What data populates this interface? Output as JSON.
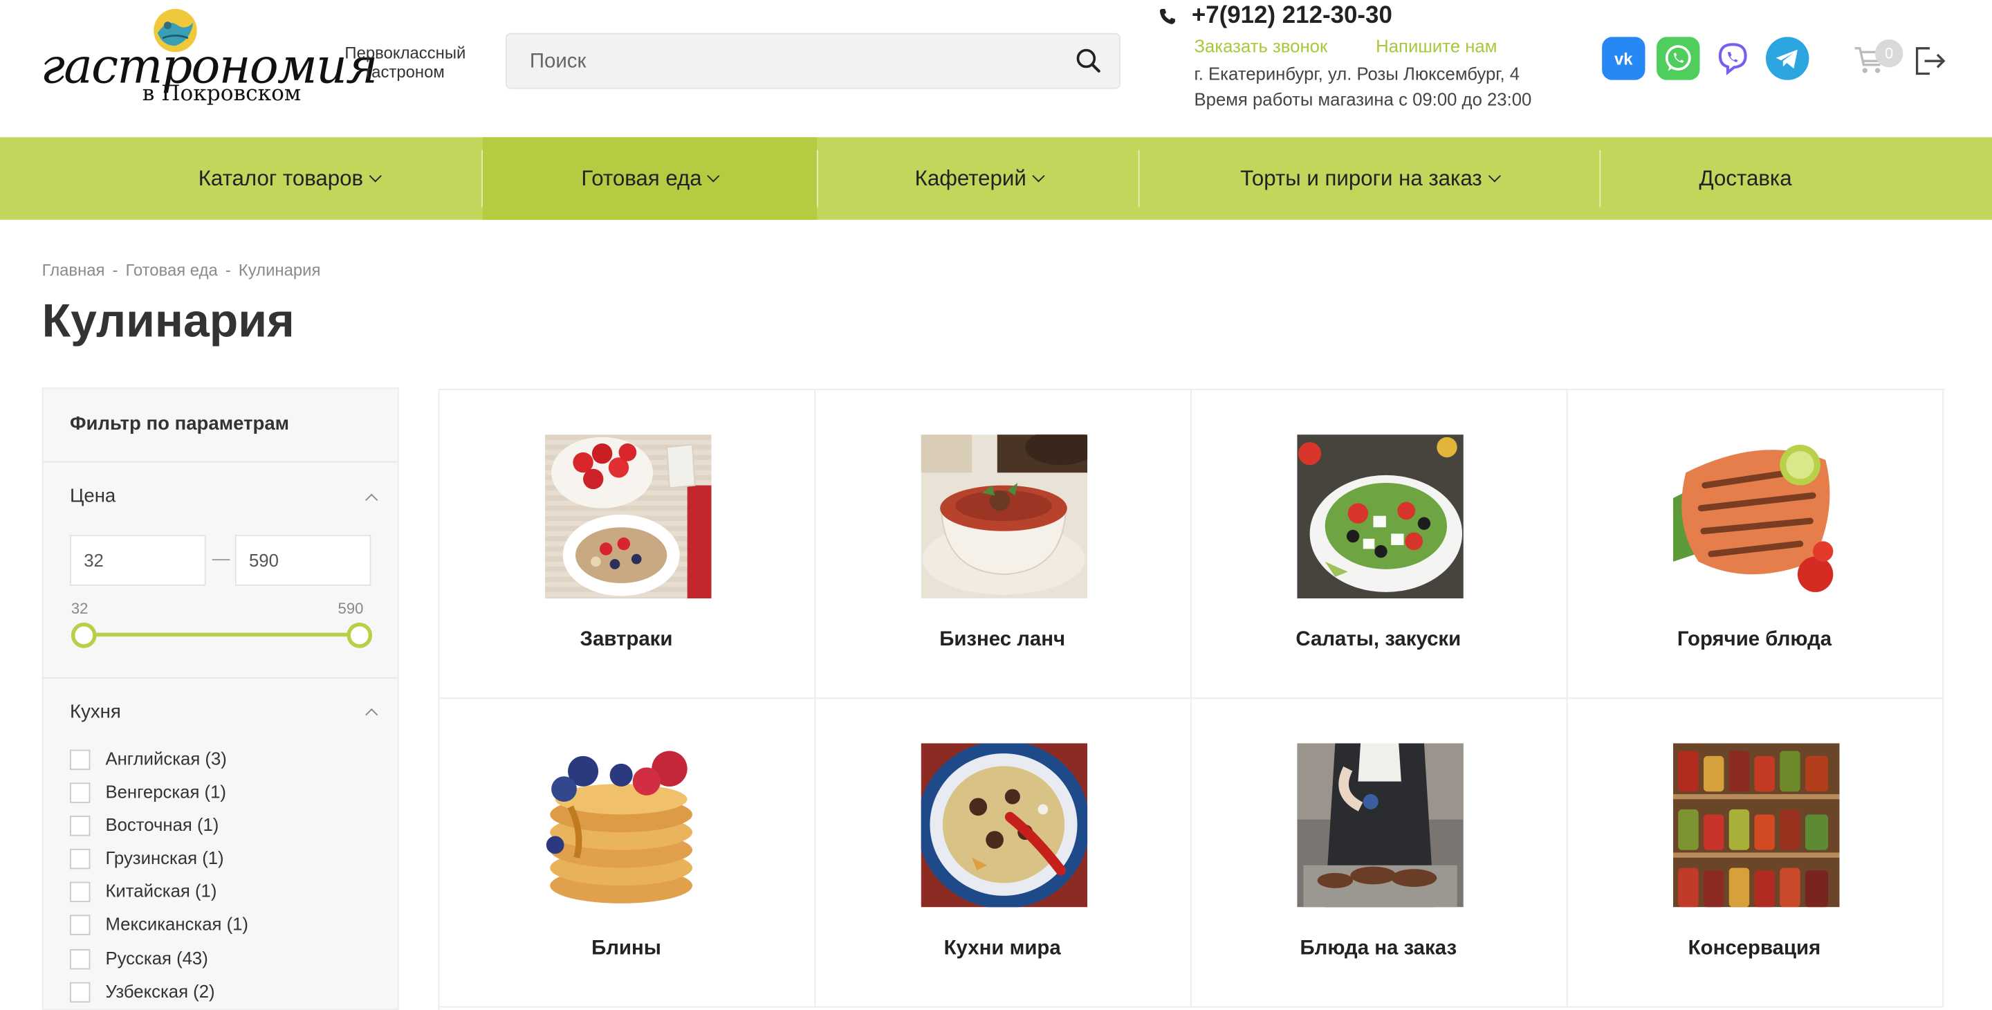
{
  "header": {
    "logo_text": "гастрономия",
    "logo_sub": "в Покровском",
    "tagline": "Первоклассный гастроном",
    "search_placeholder": "Поиск",
    "phone": "+7(912) 212-30-30",
    "callback": "Заказать звонок",
    "write_us": "Напишите нам",
    "address": "г. Екатеринбург, ул. Розы Люксембург, 4",
    "hours": "Время работы магазина с 09:00 до 23:00",
    "social": [
      {
        "name": "vk-icon",
        "color": "#2787f5"
      },
      {
        "name": "whatsapp-icon",
        "color": "#4fce5d"
      },
      {
        "name": "viber-icon",
        "color": "#7360f2"
      },
      {
        "name": "telegram-icon",
        "color": "#2ca5e0"
      }
    ],
    "cart_count": "0"
  },
  "nav": [
    {
      "label": "Каталог товаров",
      "has_dropdown": true
    },
    {
      "label": "Готовая еда",
      "has_dropdown": true,
      "active": true
    },
    {
      "label": "Кафетерий",
      "has_dropdown": true
    },
    {
      "label": "Торты и пироги на заказ",
      "has_dropdown": true
    },
    {
      "label": "Доставка",
      "has_dropdown": false
    }
  ],
  "breadcrumbs": [
    "Главная",
    "Готовая еда",
    "Кулинария"
  ],
  "page_title": "Кулинария",
  "filter": {
    "title": "Фильтр по параметрам",
    "price": {
      "title": "Цена",
      "min_value": "32",
      "max_value": "590",
      "range_min_label": "32",
      "range_max_label": "590"
    },
    "cuisine": {
      "title": "Кухня",
      "options": [
        "Английская (3)",
        "Венгерская (1)",
        "Восточная (1)",
        "Грузинская (1)",
        "Китайская (1)",
        "Мексиканская (1)",
        "Русская (43)",
        "Узбекская (2)"
      ]
    }
  },
  "categories": [
    {
      "label": "Завтраки",
      "image": "breakfast-image"
    },
    {
      "label": "Бизнес ланч",
      "image": "soup-image"
    },
    {
      "label": "Салаты, закуски",
      "image": "salad-image"
    },
    {
      "label": "Горячие блюда",
      "image": "grilled-fish-image"
    },
    {
      "label": "Блины",
      "image": "pancakes-image"
    },
    {
      "label": "Кухни мира",
      "image": "pilaf-image"
    },
    {
      "label": "Блюда на заказ",
      "image": "chef-image"
    },
    {
      "label": "Консервация",
      "image": "jars-image"
    }
  ],
  "colors": {
    "accent_green": "#c3d55a",
    "active_green": "#b5cb42",
    "link_green": "#a8c83c"
  }
}
